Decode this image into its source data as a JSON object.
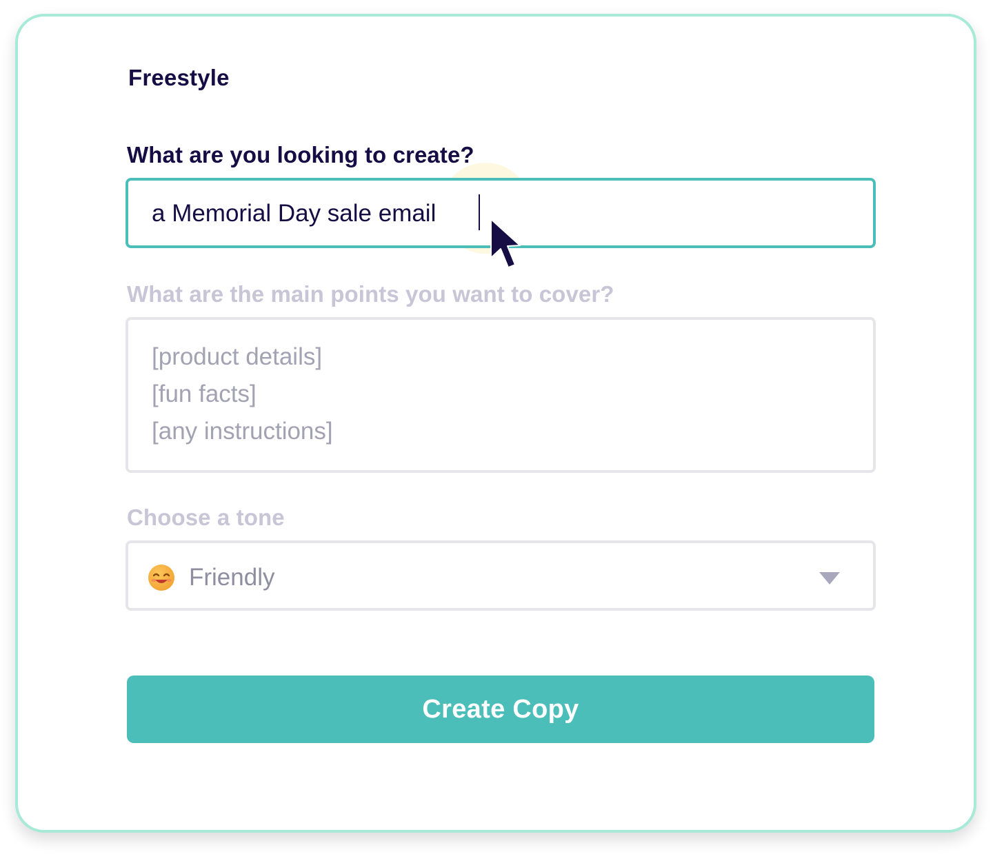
{
  "form": {
    "title": "Freestyle",
    "create_question": {
      "label": "What are you looking to create?",
      "value": "a Memorial Day sale email"
    },
    "points_question": {
      "label": "What are the main points you want to cover?",
      "placeholder_lines": [
        "[product details]",
        "[fun facts]",
        "[any instructions]"
      ]
    },
    "tone": {
      "label": "Choose a tone",
      "selected": "Friendly",
      "icon": "smiling-face-icon"
    },
    "submit_label": "Create Copy"
  },
  "colors": {
    "accent": "#4bbeb9",
    "card_border": "#a6ead7",
    "heading": "#160d45",
    "muted_label": "#c7c5d6",
    "placeholder": "#a3a2b3"
  }
}
